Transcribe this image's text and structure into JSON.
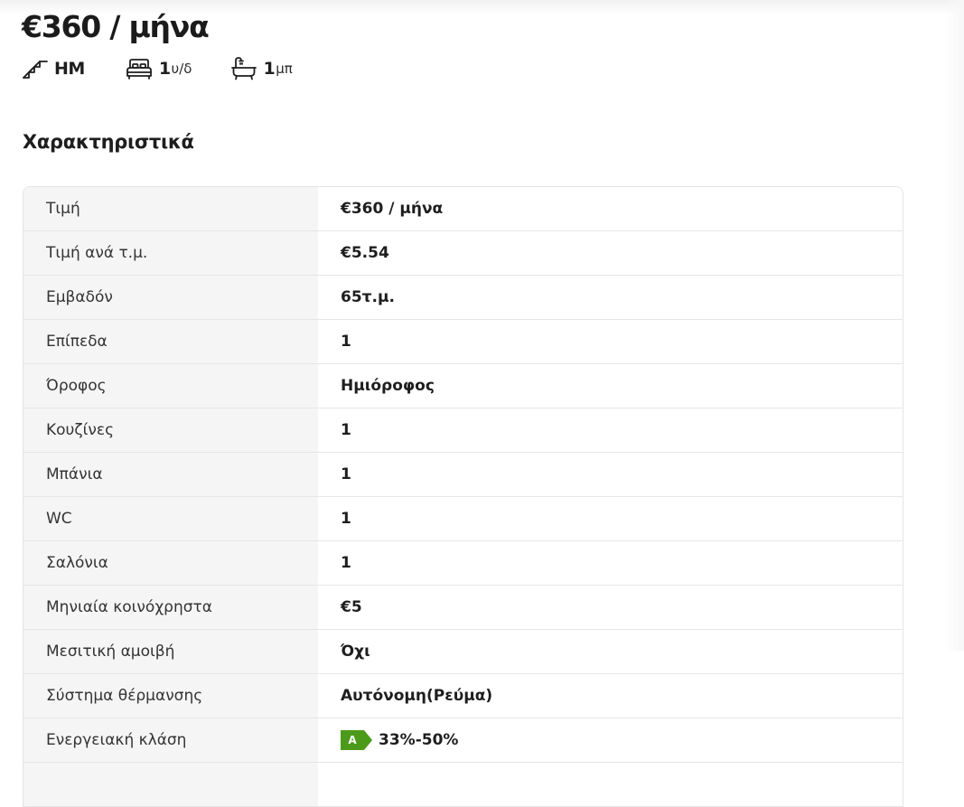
{
  "listing": {
    "price": "€360 / μήνα",
    "features": [
      {
        "icon": "stairs-icon",
        "value": "ΗΜ",
        "unit": ""
      },
      {
        "icon": "bed-icon",
        "value": "1",
        "unit": "υ/δ"
      },
      {
        "icon": "bathtub-icon",
        "value": "1",
        "unit": "μπ"
      }
    ]
  },
  "characteristics": {
    "title": "Χαρακτηριστικά",
    "rows": [
      {
        "label": "Τιμή",
        "value": "€360 / μήνα"
      },
      {
        "label": "Τιμή ανά τ.μ.",
        "value": "€5.54"
      },
      {
        "label": "Εμβαδόν",
        "value": "65τ.μ."
      },
      {
        "label": "Επίπεδα",
        "value": "1"
      },
      {
        "label": "Όροφος",
        "value": "Ημιόροφος"
      },
      {
        "label": "Κουζίνες",
        "value": "1"
      },
      {
        "label": "Μπάνια",
        "value": "1"
      },
      {
        "label": "WC",
        "value": "1"
      },
      {
        "label": "Σαλόνια",
        "value": "1"
      },
      {
        "label": "Μηνιαία κοινόχρηστα",
        "value": "€5"
      },
      {
        "label": "Μεσιτική αμοιβή",
        "value": "Όχι"
      },
      {
        "label": "Σύστημα θέρμανσης",
        "value": "Αυτόνομη(Ρεύμα)"
      },
      {
        "label": "Ενεργειακή κλάση",
        "value": "33%-50%",
        "badge": "A",
        "badge_color": "#4c9a1a"
      }
    ]
  }
}
